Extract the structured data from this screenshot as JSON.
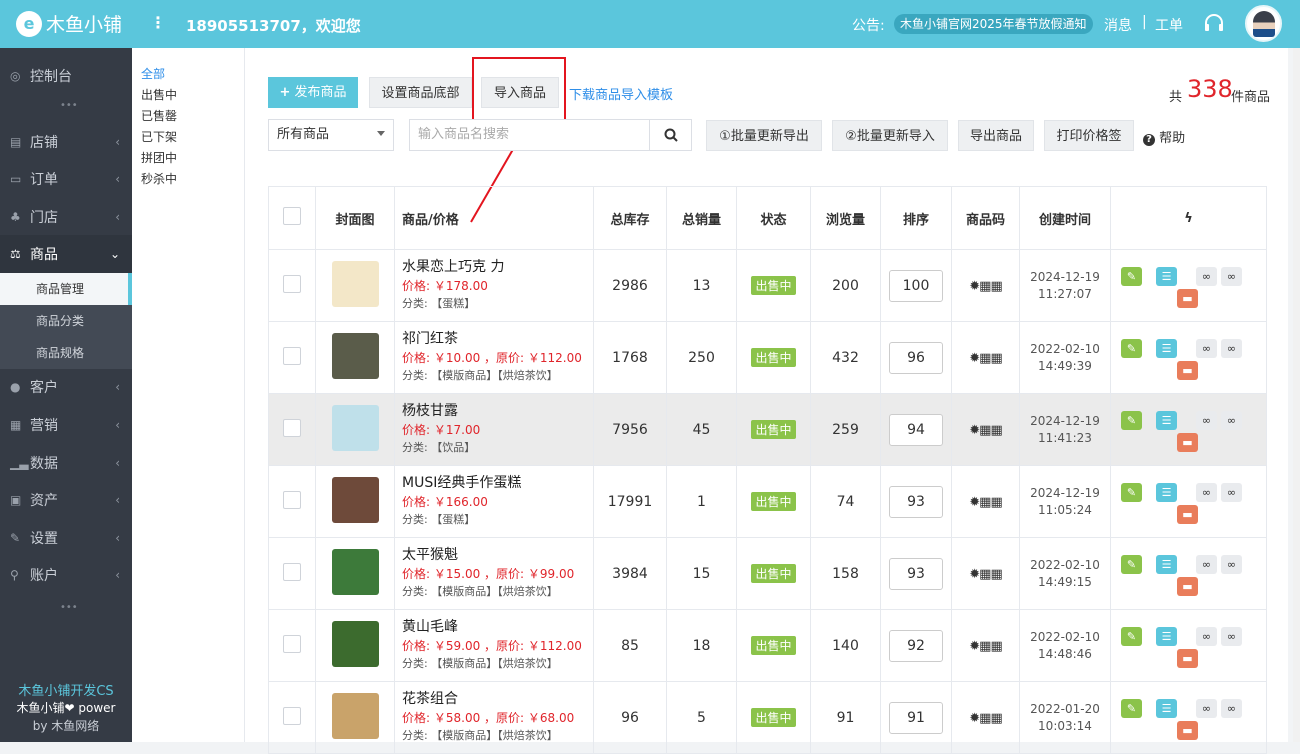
{
  "app": {
    "logo_text": "木鱼小铺",
    "logo_mark": "e"
  },
  "header": {
    "menu_icon": "more-vertical-icon",
    "welcome": "18905513707，欢迎您",
    "notice_label": "公告:",
    "notice_text": "木鱼小铺官网2025年春节放假通知",
    "messages": "消息",
    "separator": "|",
    "tickets": "工单"
  },
  "sidebar": {
    "items": [
      {
        "label": "控制台",
        "icon": "dashboard-icon"
      },
      {
        "label": "店铺",
        "icon": "store-icon"
      },
      {
        "label": "订单",
        "icon": "order-icon"
      },
      {
        "label": "门店",
        "icon": "branch-icon"
      },
      {
        "label": "商品",
        "icon": "goods-icon"
      },
      {
        "label": "客户",
        "icon": "customer-icon"
      },
      {
        "label": "营销",
        "icon": "marketing-icon"
      },
      {
        "label": "数据",
        "icon": "data-icon"
      },
      {
        "label": "资产",
        "icon": "asset-icon"
      },
      {
        "label": "设置",
        "icon": "settings-icon"
      },
      {
        "label": "账户",
        "icon": "account-icon"
      }
    ],
    "sub_items": [
      "商品管理",
      "商品分类",
      "商品规格"
    ],
    "footer_title": "木鱼小铺开发CS",
    "footer_power": "木鱼小铺❤ power",
    "footer_by": "by 木鱼网络"
  },
  "categories": [
    "全部",
    "出售中",
    "已售罄",
    "已下架",
    "拼团中",
    "秒杀中"
  ],
  "toolbar": {
    "publish": "发布商品",
    "set_bottom": "设置商品底部",
    "import": "导入商品",
    "download_template": "下载商品导入模板",
    "count_prefix": "共",
    "count": "338",
    "count_suffix": "件商品",
    "filter_value": "所有商品",
    "search_placeholder": "输入商品名搜索",
    "batch_export": "①批量更新导出",
    "batch_import": "②批量更新导入",
    "export": "导出商品",
    "print_label": "打印价格签",
    "help": "帮助"
  },
  "table": {
    "headers": [
      "封面图",
      "商品/价格",
      "总库存",
      "总销量",
      "状态",
      "浏览量",
      "排序",
      "商品码",
      "创建时间"
    ],
    "action_header_icon": "bolt-icon",
    "rows": [
      {
        "name": "水果恋上巧克 力",
        "price": "价格: ￥178.00",
        "category": "分类: 【蛋糕】",
        "stock": "2986",
        "sales": "13",
        "status": "出售中",
        "views": "200",
        "sort": "100",
        "date": "2024-12-19",
        "time": "11:27:07",
        "thumb_color": "#f3e7c8"
      },
      {
        "name": "祁门红茶",
        "price": "价格: ￥10.00 ，原价: ￥112.00",
        "category": "分类: 【模版商品】【烘焙茶饮】",
        "stock": "1768",
        "sales": "250",
        "status": "出售中",
        "views": "432",
        "sort": "96",
        "date": "2022-02-10",
        "time": "14:49:39",
        "thumb_color": "#5a5c4a"
      },
      {
        "name": "杨枝甘露",
        "price": "价格: ￥17.00",
        "category": "分类: 【饮品】",
        "stock": "7956",
        "sales": "45",
        "status": "出售中",
        "views": "259",
        "sort": "94",
        "date": "2024-12-19",
        "time": "11:41:23",
        "thumb_color": "#bfe0ea"
      },
      {
        "name": "MUSI经典手作蛋糕",
        "price": "价格: ￥166.00",
        "category": "分类: 【蛋糕】",
        "stock": "17991",
        "sales": "1",
        "status": "出售中",
        "views": "74",
        "sort": "93",
        "date": "2024-12-19",
        "time": "11:05:24",
        "thumb_color": "#6e4a3a"
      },
      {
        "name": "太平猴魁",
        "price": "价格: ￥15.00 ，原价: ￥99.00",
        "category": "分类: 【模版商品】【烘焙茶饮】",
        "stock": "3984",
        "sales": "15",
        "status": "出售中",
        "views": "158",
        "sort": "93",
        "date": "2022-02-10",
        "time": "14:49:15",
        "thumb_color": "#3d7a3a"
      },
      {
        "name": "黄山毛峰",
        "price": "价格: ￥59.00 ，原价: ￥112.00",
        "category": "分类: 【模版商品】【烘焙茶饮】",
        "stock": "85",
        "sales": "18",
        "status": "出售中",
        "views": "140",
        "sort": "92",
        "date": "2022-02-10",
        "time": "14:48:46",
        "thumb_color": "#3c6b2e"
      },
      {
        "name": "花茶组合",
        "price": "价格: ￥58.00 ，原价: ￥68.00",
        "category": "分类: 【模版商品】【烘焙茶饮】",
        "stock": "96",
        "sales": "5",
        "status": "出售中",
        "views": "91",
        "sort": "91",
        "date": "2022-01-20",
        "time": "10:03:14",
        "thumb_color": "#c9a36a"
      }
    ]
  },
  "colors": {
    "accent": "#5bc6dc",
    "sidebar": "#353b45",
    "price": "#e0252b",
    "status": "#8bc34a",
    "highlight_box": "#e3151f"
  }
}
